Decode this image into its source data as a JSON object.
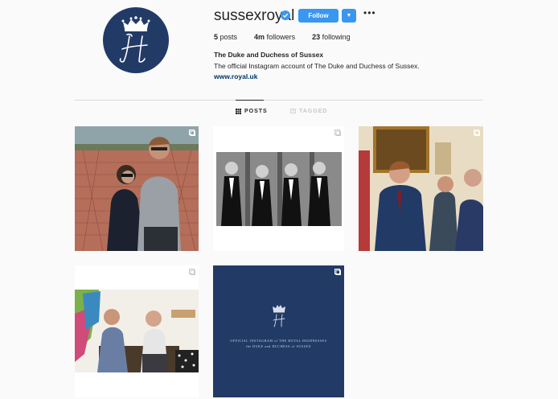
{
  "profile": {
    "username": "sussexroyal",
    "follow_label": "Follow",
    "dropdown_icon": "caret-down-icon",
    "more_icon": "ellipsis-icon",
    "stats": {
      "posts_value": "5",
      "posts_label": "posts",
      "followers_value": "4m",
      "followers_label": "followers",
      "following_value": "23",
      "following_label": "following"
    },
    "full_name": "The Duke and Duchess of Sussex",
    "bio": "The official Instagram account of The Duke and Duchess of Sussex.",
    "website": "www.royal.uk"
  },
  "tabs": [
    {
      "label": "POSTS",
      "icon": "grid-icon",
      "active": true
    },
    {
      "label": "TAGGED",
      "icon": "tag-icon",
      "active": false
    }
  ],
  "posts": [
    {
      "alt": "Couple posing outdoors by a brick wall"
    },
    {
      "alt": "Black and white group photo of men in tuxedos"
    },
    {
      "alt": "Prince meeting people at an indoor reception"
    },
    {
      "alt": "Two men seated talking in a colorful room"
    },
    {
      "alt": "Official Instagram announcement card",
      "line1": "OFFICIAL INSTAGRAM of THE ROYAL HIGHNESSES",
      "line2": "the DUKE and DUCHESS of SUSSEX"
    }
  ],
  "colors": {
    "accent": "#3897f0",
    "navy": "#223a66",
    "link": "#003569"
  }
}
